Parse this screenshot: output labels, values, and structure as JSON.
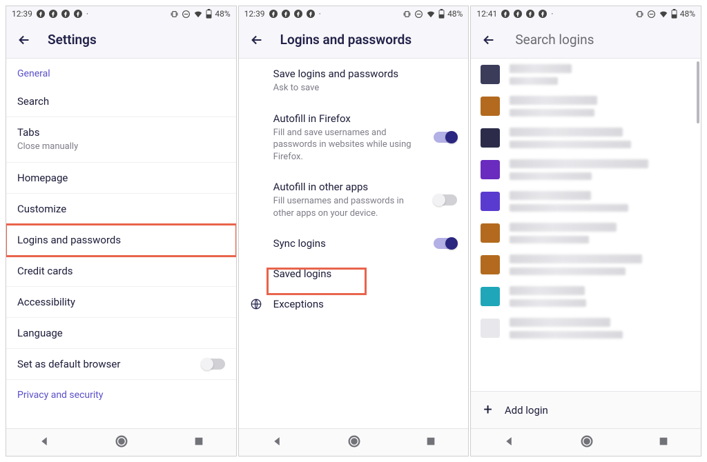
{
  "status": {
    "time_a": "12:39",
    "time_b": "12:39",
    "time_c": "12:41",
    "battery": "48%"
  },
  "panel1": {
    "title": "Settings",
    "section_general": "General",
    "items": {
      "search": "Search",
      "tabs": "Tabs",
      "tabs_sub": "Close manually",
      "homepage": "Homepage",
      "customize": "Customize",
      "logins": "Logins and passwords",
      "credit": "Credit cards",
      "accessibility": "Accessibility",
      "language": "Language",
      "default_browser": "Set as default browser",
      "section_privacy": "Privacy and security"
    },
    "toggles": {
      "default_browser": false
    }
  },
  "panel2": {
    "title": "Logins and passwords",
    "rows": {
      "save": "Save logins and passwords",
      "save_sub": "Ask to save",
      "autofill_ff": "Autofill in Firefox",
      "autofill_ff_sub": "Fill and save usernames and passwords in websites while using Firefox.",
      "autofill_other": "Autofill in other apps",
      "autofill_other_sub": "Fill usernames and passwords in other apps on your device.",
      "sync": "Sync logins",
      "saved": "Saved logins",
      "exceptions": "Exceptions"
    },
    "toggles": {
      "autofill_ff": true,
      "autofill_other": false,
      "sync": true
    }
  },
  "panel3": {
    "title": "Search logins",
    "add_login": "Add login",
    "favicons": [
      "#3b3c5a",
      "#b36a1e",
      "#2c2c4a",
      "#6a2bbf",
      "#5a3bd0",
      "#b36a1e",
      "#b36a1e",
      "#1fa6b8",
      "#e8e8ec"
    ]
  }
}
